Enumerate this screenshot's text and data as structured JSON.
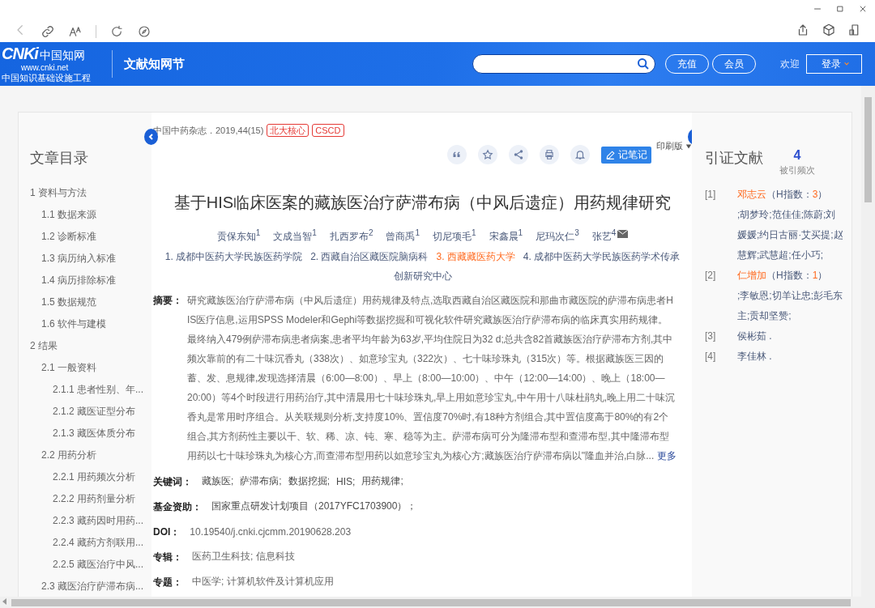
{
  "header": {
    "logo": {
      "mark": "CNKi",
      "name": "中国知网",
      "url": "www.cnki.net",
      "tagline": "中国知识基础设施工程"
    },
    "section_title": "文献知网节",
    "buttons": [
      "充值",
      "会员"
    ],
    "welcome": "欢迎",
    "login": "登录"
  },
  "toc": {
    "title": "文章目录",
    "items": [
      {
        "label": "1 资料与方法",
        "children": [
          {
            "label": "1.1 数据来源"
          },
          {
            "label": "1.2 诊断标准"
          },
          {
            "label": "1.3 病历纳入标准"
          },
          {
            "label": "1.4 病历排除标准"
          },
          {
            "label": "1.5 数据规范"
          },
          {
            "label": "1.6 软件与建模"
          }
        ]
      },
      {
        "label": "2 结果",
        "children": [
          {
            "label": "2.1 一般资料",
            "children": [
              {
                "label": "2.1.1 患者性别、年..."
              },
              {
                "label": "2.1.2 藏医证型分布"
              },
              {
                "label": "2.1.3 藏医体质分布"
              }
            ]
          },
          {
            "label": "2.2 用药分析",
            "children": [
              {
                "label": "2.2.1 用药频次分析"
              },
              {
                "label": "2.2.2 用药剂量分析"
              },
              {
                "label": "2.2.3 藏药因时用药..."
              },
              {
                "label": "2.2.4 藏药方剂联用..."
              },
              {
                "label": "2.2.5 藏医治疗中风..."
              }
            ]
          },
          {
            "label": "2.3 藏医治疗萨滞布病..."
          }
        ]
      }
    ]
  },
  "article": {
    "source": "中国中药杂志．2019,44(15)",
    "tags": [
      "北大核心",
      "CSCD"
    ],
    "note_button": "记笔记",
    "print_version": "印刷版",
    "title": "基于HIS临床医案的藏族医治疗萨滞布病（中风后遗症）用药规律研究",
    "authors": [
      {
        "name": "贡保东知",
        "mark": "1",
        "has_email": false
      },
      {
        "name": "文成当智",
        "mark": "1",
        "has_email": false
      },
      {
        "name": "扎西罗布",
        "mark": "2",
        "has_email": false
      },
      {
        "name": "曾商禹",
        "mark": "1",
        "has_email": false
      },
      {
        "name": "切尼项毛",
        "mark": "1",
        "has_email": false
      },
      {
        "name": "宋鑫晨",
        "mark": "1",
        "has_email": false
      },
      {
        "name": "尼玛次仁",
        "mark": "3",
        "has_email": false
      },
      {
        "name": "张艺",
        "mark": "4",
        "has_email": true
      }
    ],
    "affiliations": [
      {
        "text": "1. 成都中医药大学民族医药学院",
        "highlighted": false
      },
      {
        "text": "2. 西藏自治区藏医院脑病科",
        "highlighted": false
      },
      {
        "text": "3. 西藏藏医药大学",
        "highlighted": true
      },
      {
        "text": "4. 成都中医药大学民族医药学术传承",
        "highlighted": false
      },
      {
        "text": "创新研究中心",
        "highlighted": false
      }
    ],
    "abstract": {
      "label": "摘要：",
      "more": "更多",
      "lines": [
        "研究藏族医治疗萨滞布病（中风后遗症）用药规律及特点,选取西藏自治区藏医院和那曲市藏医院的萨滞布病患者H",
        "IS医疗信息,运用SPSS Modeler和Gephi等数据挖掘和可视化软件研究藏族医治疗萨滞布病的临床真实用药规律。",
        "最终纳入479例萨滞布病患者病案,患者平均年龄为63岁,平均住院日为32 d;总共含82首藏族医治疗萨滞布方剂,其中",
        "频次靠前的有二十味沉香丸（338次）、如意珍宝丸（322次）、七十味珍珠丸（315次）等。根据藏族医三因的",
        "蓄、发、息规律,发现选择清晨（6:00—8:00）、早上（8:00—10:00）、中午（12:00—14:00）、晚上（18:00—",
        "20:00）等4个时段进行用药治疗,其中清晨用七十味珍珠丸,早上用如意珍宝丸,中午用十八味杜鹃丸,晚上用二十味沉",
        "香丸是常用时序组合。从关联规则分析,支持度10%、置信度70%时,有18种方剂组合,其中置信度高于80%的有2个",
        "组合,其方剂药性主要以干、软、稀、凉、钝、寒、稳等为主。萨滞布病可分为隆滞布型和查滞布型,其中隆滞布型",
        "用药以七十味珍珠丸为核心方,而查滞布型用药以如意珍宝丸为核心方;藏族医治疗萨滞布病以\"隆血并治,白脉..."
      ]
    },
    "fields": [
      {
        "label": "关键词：",
        "kind": "links",
        "values": [
          "藏族医;",
          "萨滞布病;",
          "数据挖掘;",
          "HIS;",
          "用药规律;"
        ]
      },
      {
        "label": "基金资助：",
        "kind": "links",
        "values": [
          "国家重点研发计划项目（2017YFC1703900）；"
        ]
      },
      {
        "label": "DOI：",
        "kind": "text",
        "values": [
          "10.19540/j.cnki.cjcmm.20190628.203"
        ]
      },
      {
        "label": "专辑：",
        "kind": "text",
        "values": [
          "医药卫生科技; 信息科技"
        ]
      },
      {
        "label": "专题：",
        "kind": "text",
        "values": [
          "中医学; 计算机软件及计算机应用"
        ]
      }
    ]
  },
  "citations": {
    "title": "引证文献",
    "count": "4",
    "count_label": "被引频次",
    "items": [
      {
        "number": "[1]",
        "author": "邓志云",
        "highlighted": true,
        "h_prefix": "（H指数：",
        "h_value": "3",
        "h_suffix": "）",
        "coauthors": ";胡梦玲;范佳佳;陈蔚;刘媛媛;约日古丽·艾买提;赵慧辉;武慧超;任小巧;"
      },
      {
        "number": "[2]",
        "author": "仁增加",
        "highlighted": true,
        "h_prefix": "（H指数：",
        "h_value": "1",
        "h_suffix": "）",
        "coauthors": ";李敏恩;切羊让忠;彭毛东主;贡却坚赞;"
      },
      {
        "number": "[3]",
        "author": "侯彬茹 .",
        "highlighted": false
      },
      {
        "number": "[4]",
        "author": "李佳林 .",
        "highlighted": false
      }
    ]
  }
}
